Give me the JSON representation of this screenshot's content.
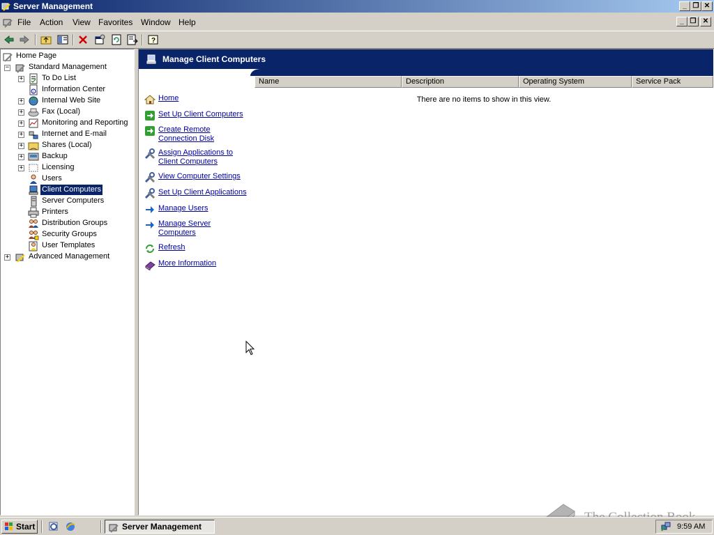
{
  "window": {
    "title": "Server Management"
  },
  "menubar": {
    "items": [
      "File",
      "Action",
      "View",
      "Favorites",
      "Window",
      "Help"
    ]
  },
  "toolbar": {
    "buttons": [
      "back-icon",
      "forward-icon",
      "up-folder-icon",
      "show-hide-tree-icon",
      "delete-icon",
      "properties-icon",
      "refresh-icon",
      "export-list-icon",
      "help-icon"
    ]
  },
  "tree": {
    "home": "Home Page",
    "standard": "Standard Management",
    "items": [
      "To Do List",
      "Information Center",
      "Internal Web Site",
      "Fax (Local)",
      "Monitoring and Reporting",
      "Internet and E-mail",
      "Shares (Local)",
      "Backup",
      "Licensing",
      "Users",
      "Client Computers",
      "Server Computers",
      "Printers",
      "Distribution Groups",
      "Security Groups",
      "User Templates"
    ],
    "advanced": "Advanced Management",
    "selected": "Client Computers"
  },
  "main": {
    "title": "Manage Client Computers",
    "tasks": [
      {
        "label": "Home",
        "icon": "home-icon"
      },
      {
        "label": "Set Up Client Computers",
        "icon": "green-arrow-icon"
      },
      {
        "label": "Create Remote",
        "label2": "Connection Disk",
        "icon": "green-arrow-icon"
      },
      {
        "label": "Assign Applications to",
        "label2": "Client Computers",
        "icon": "tools-icon"
      },
      {
        "label": "View Computer Settings",
        "icon": "tools-icon"
      },
      {
        "label": "Set Up Client Applications",
        "icon": "tools-icon"
      },
      {
        "label": "Manage Users",
        "icon": "blue-arrow-icon"
      },
      {
        "label": "Manage Server",
        "label2": "Computers",
        "icon": "blue-arrow-icon"
      },
      {
        "label": "Refresh",
        "icon": "refresh-icon"
      },
      {
        "label": "More Information",
        "icon": "book-icon"
      }
    ],
    "columns": [
      "Name",
      "Description",
      "Operating System",
      "Service Pack"
    ],
    "empty_message": "There are no items to show in this view."
  },
  "taskbar": {
    "start": "Start",
    "task": "Server Management",
    "clock": "9:59 AM"
  },
  "watermark": {
    "text": "The Collection Book"
  },
  "colors": {
    "titlebar": "#0a246a",
    "banner": "#0a246a",
    "link": "#0000a0",
    "selection": "#0a246a"
  }
}
